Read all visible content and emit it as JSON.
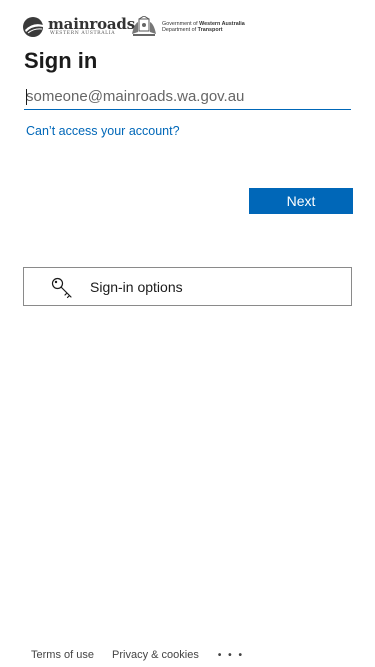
{
  "branding": {
    "mainroads_name": "mainroads",
    "mainroads_sub": "WESTERN AUSTRALIA",
    "gov_line1_prefix": "Government of ",
    "gov_line1_bold": "Western Australia",
    "gov_line2_prefix": "Department of ",
    "gov_line2_bold": "Transport"
  },
  "signin": {
    "title": "Sign in",
    "email_placeholder": "someone@mainroads.wa.gov.au",
    "email_value": "",
    "cant_access_label": "Can’t access your account?",
    "next_label": "Next"
  },
  "signin_options": {
    "label": "Sign-in options",
    "icon": "key-icon"
  },
  "footer": {
    "terms_label": "Terms of use",
    "privacy_label": "Privacy & cookies",
    "more_label": "• • •"
  },
  "colors": {
    "accent": "#0067b8",
    "text": "#1b1b1b",
    "border": "#8a8a8a"
  }
}
